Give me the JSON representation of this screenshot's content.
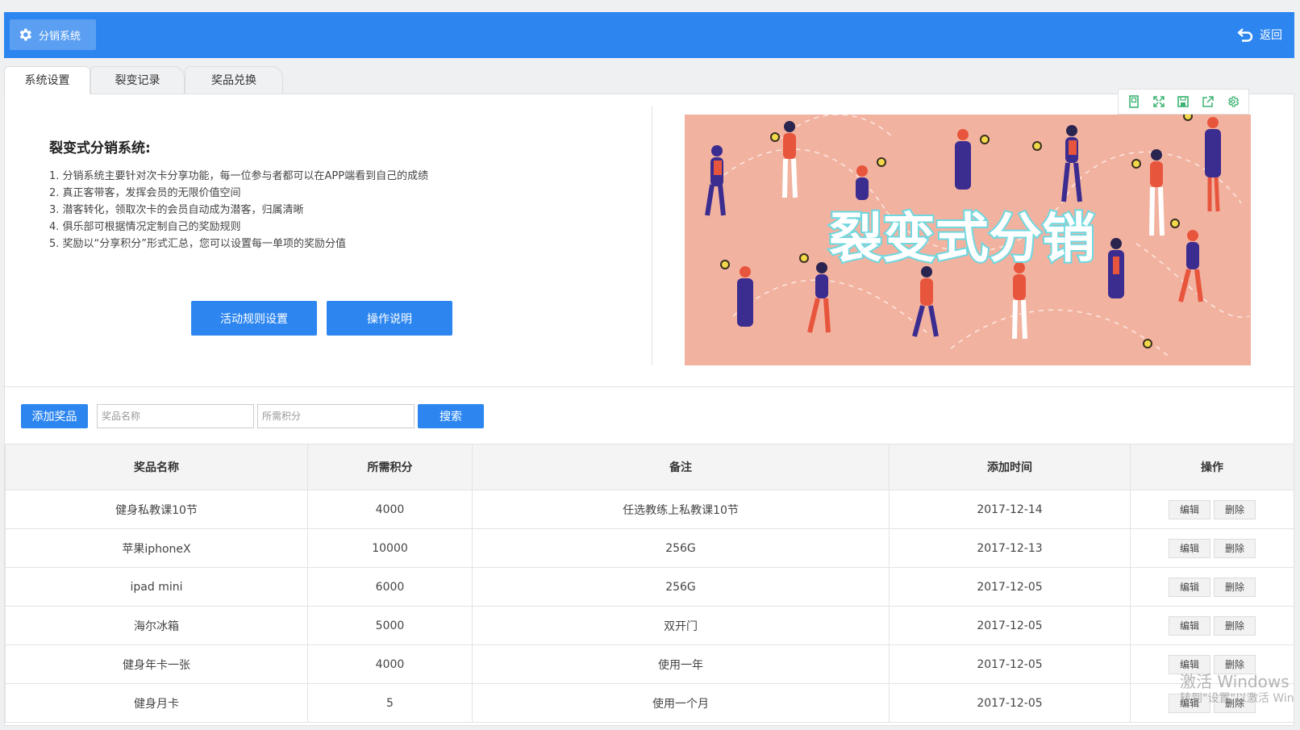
{
  "header": {
    "app_title": "分销系统",
    "back_label": "返回"
  },
  "tabs": [
    {
      "label": "系统设置",
      "active": true
    },
    {
      "label": "裂变记录",
      "active": false
    },
    {
      "label": "奖品兑换",
      "active": false
    }
  ],
  "intro": {
    "title": "裂变式分销系统:",
    "items": [
      "1. 分销系统主要针对次卡分享功能，每一位参与者都可以在APP端看到自己的成绩",
      "2. 真正客带客，发挥会员的无限价值空间",
      "3. 潜客转化，领取次卡的会员自动成为潜客，归属清晰",
      "4. 俱乐部可根据情况定制自己的奖励规则",
      "5. 奖励以“分享积分”形式汇总，您可以设置每一单项的奖励分值"
    ],
    "rule_button": "活动规则设置",
    "help_button": "操作说明"
  },
  "banner": {
    "text": "裂变式分销",
    "bg_color": "#f2b2a0"
  },
  "toolbox_icons": [
    "view-icon",
    "fullscreen-icon",
    "save-icon",
    "share-icon",
    "settings-icon"
  ],
  "search": {
    "add_button": "添加奖品",
    "name_placeholder": "奖品名称",
    "points_placeholder": "所需积分",
    "search_button": "搜索"
  },
  "table": {
    "headers": [
      "奖品名称",
      "所需积分",
      "备注",
      "添加时间",
      "操作"
    ],
    "edit_label": "编辑",
    "delete_label": "删除",
    "rows": [
      {
        "name": "健身私教课10节",
        "points": "4000",
        "note": "任选教练上私教课10节",
        "date": "2017-12-14"
      },
      {
        "name": "苹果iphoneX",
        "points": "10000",
        "note": "256G",
        "date": "2017-12-13"
      },
      {
        "name": "ipad mini",
        "points": "6000",
        "note": "256G",
        "date": "2017-12-05"
      },
      {
        "name": "海尔冰箱",
        "points": "5000",
        "note": "双开门",
        "date": "2017-12-05"
      },
      {
        "name": "健身年卡一张",
        "points": "4000",
        "note": "使用一年",
        "date": "2017-12-05"
      },
      {
        "name": "健身月卡",
        "points": "5",
        "note": "使用一个月",
        "date": "2017-12-05"
      }
    ]
  },
  "watermark": {
    "line1": "激活 Windows",
    "line2": "转到\"设置\"以激活 Win"
  },
  "colors": {
    "primary": "#2d86f0"
  }
}
